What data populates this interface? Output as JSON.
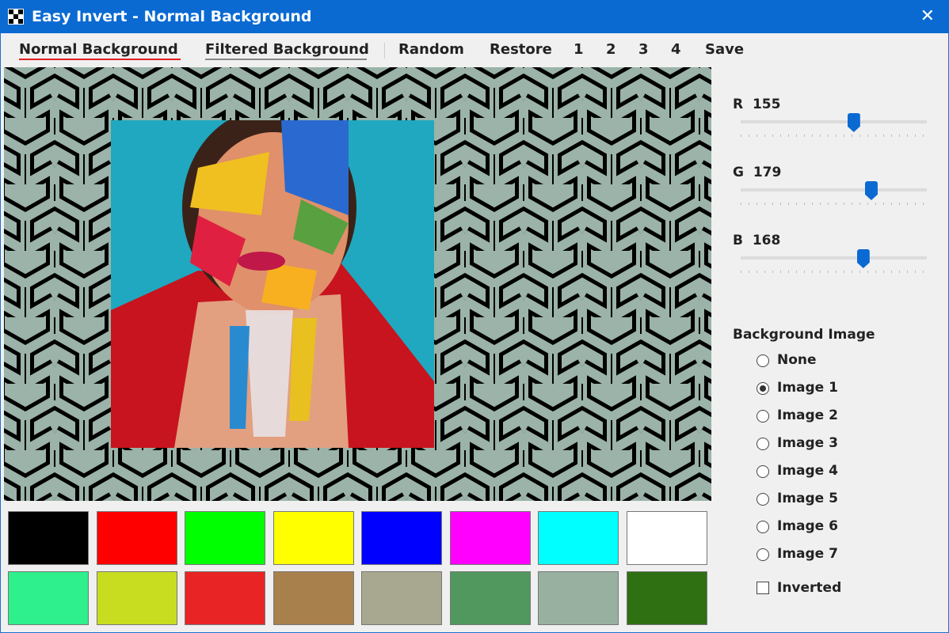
{
  "window": {
    "title": "Easy Invert - Normal Background",
    "close": "✕"
  },
  "menu": {
    "normal": "Normal Background",
    "filtered": "Filtered Background",
    "random": "Random",
    "restore": "Restore",
    "p1": "1",
    "p2": "2",
    "p3": "3",
    "p4": "4",
    "save": "Save"
  },
  "sliders": [
    {
      "label": "R",
      "value": 155
    },
    {
      "label": "G",
      "value": 179
    },
    {
      "label": "B",
      "value": 168
    }
  ],
  "slider_max": 255,
  "background": {
    "heading": "Background Image",
    "options": [
      "None",
      "Image 1",
      "Image 2",
      "Image 3",
      "Image 4",
      "Image 5",
      "Image 6",
      "Image 7"
    ],
    "selected": 1,
    "inverted_label": "Inverted",
    "inverted": false
  },
  "swatches": [
    "#000000",
    "#ff0000",
    "#00ff00",
    "#ffff00",
    "#0000ff",
    "#ff00ff",
    "#00ffff",
    "#ffffff",
    "#2ef08c",
    "#c8dc20",
    "#e82424",
    "#a8804c",
    "#a8a890",
    "#50985e",
    "#98b0a0",
    "#2e7012"
  ],
  "colors": {
    "accent": "#0a6ad2",
    "canvas_bg": "#9bb3a8"
  }
}
